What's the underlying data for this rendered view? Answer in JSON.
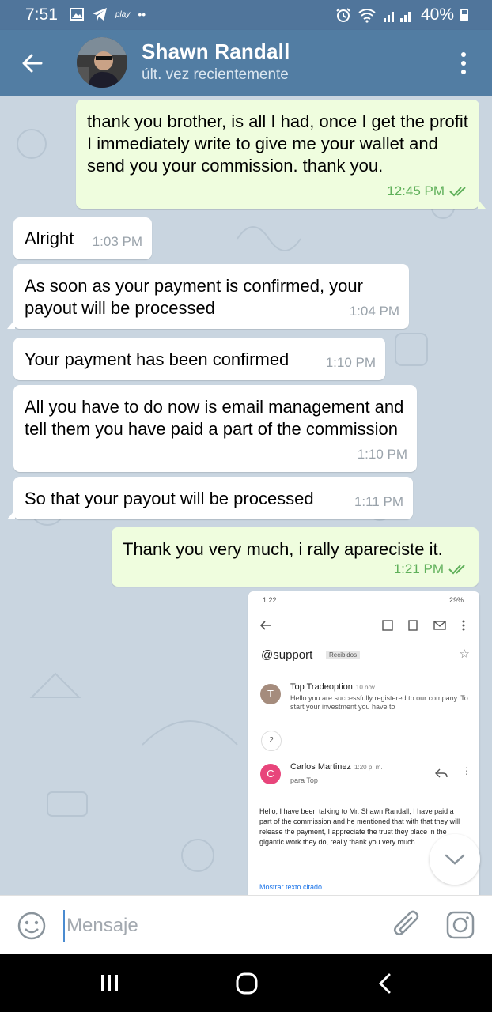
{
  "status_bar": {
    "time": "7:51",
    "small_label": "play",
    "dots": "••",
    "battery": "40%"
  },
  "header": {
    "name": "Shawn Randall",
    "status": "últ. vez recientemente"
  },
  "messages": [
    {
      "dir": "out",
      "text": "thank you brother, is all I had, once I get the profit I immediately write to give me your wallet and send you your commission. thank you.",
      "time": "12:45 PM"
    },
    {
      "dir": "in",
      "text": "Alright",
      "time": "1:03 PM"
    },
    {
      "dir": "in",
      "text": "As soon as your payment is confirmed, your payout will be processed",
      "time": "1:04 PM"
    },
    {
      "dir": "in",
      "text": "Your payment has been confirmed",
      "time": "1:10 PM"
    },
    {
      "dir": "in",
      "text": "All you have to do now is email management and tell them you have paid a part of the commission",
      "time": "1:10 PM"
    },
    {
      "dir": "in",
      "text": "So that your payout will be processed",
      "time": "1:11 PM"
    },
    {
      "dir": "out",
      "text": "Thank you very much, i rally apareciste it.",
      "time": "1:21 PM"
    }
  ],
  "email_screenshot": {
    "status_time": "1:22",
    "status_right": "29%",
    "subject": "@support",
    "label": "Recibidos",
    "first_sender": "Top Tradeoption",
    "first_date": "10 nov.",
    "first_initial": "T",
    "first_preview": "Hello you are successfully registered to our company. To start your investment you have to",
    "count": "2",
    "second_sender": "Carlos Martinez",
    "second_time": "1:20 p. m.",
    "second_initial": "C",
    "to": "para Top",
    "body": "Hello, I have been talking to Mr. Shawn Randall, I have paid a part of the commission and he mentioned that with that they will release the payment, I appreciate the trust they place in the gigantic work they do, really thank you very much",
    "link": "Mostrar texto citado"
  },
  "input": {
    "placeholder": "Mensaje"
  },
  "colors": {
    "header": "#527da3",
    "chat_bg": "#c9d5e0",
    "bubble_out": "#effdde",
    "bubble_in": "#ffffff",
    "check": "#5fb05a"
  }
}
